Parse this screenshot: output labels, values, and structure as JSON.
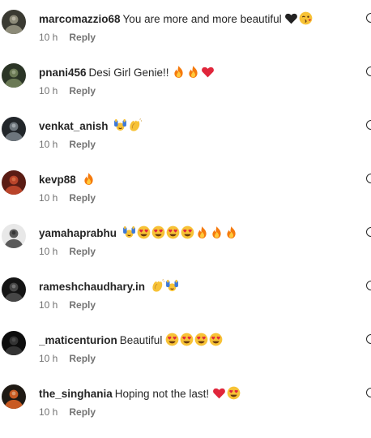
{
  "comments": [
    {
      "username": "marcomazzio68",
      "text": "You are more and more beautiful",
      "emojis": [
        "black-heart",
        "wink-kiss"
      ],
      "time": "10 h",
      "reply_label": "Reply",
      "avatar_colors": [
        "#3a3a32",
        "#8c8a78",
        "#d8d4c6"
      ]
    },
    {
      "username": "pnani456",
      "text": "Desi Girl Genie!!",
      "emojis": [
        "fire",
        "fire",
        "red-heart"
      ],
      "time": "10 h",
      "reply_label": "Reply",
      "avatar_colors": [
        "#2b3526",
        "#6b7a55",
        "#b7bfa4"
      ]
    },
    {
      "username": "venkat_anish",
      "text": "",
      "emojis": [
        "raising-hands",
        "clapping-hands"
      ],
      "time": "10 h",
      "reply_label": "Reply",
      "avatar_colors": [
        "#22262a",
        "#6d757c",
        "#c9ced2"
      ]
    },
    {
      "username": "kevp88",
      "text": "",
      "emojis": [
        "fire"
      ],
      "time": "10 h",
      "reply_label": "Reply",
      "avatar_colors": [
        "#5a1c14",
        "#b9442a",
        "#e98a56"
      ]
    },
    {
      "username": "yamahaprabhu",
      "text": "",
      "emojis": [
        "raising-hands",
        "heart-eyes",
        "heart-eyes",
        "heart-eyes",
        "heart-eyes",
        "fire",
        "fire",
        "fire"
      ],
      "time": "10 h",
      "reply_label": "Reply",
      "avatar_colors": [
        "#e8e8e8",
        "#5a5a5a",
        "#1c1c1c"
      ]
    },
    {
      "username": "rameshchaudhary.in",
      "text": "",
      "emojis": [
        "clapping-hands",
        "raising-hands"
      ],
      "time": "10 h",
      "reply_label": "Reply",
      "avatar_colors": [
        "#141414",
        "#464646",
        "#9a9a9a"
      ]
    },
    {
      "username": "_maticenturion",
      "text": "Beautiful",
      "emojis": [
        "heart-eyes",
        "heart-eyes",
        "heart-eyes",
        "heart-eyes"
      ],
      "time": "10 h",
      "reply_label": "Reply",
      "avatar_colors": [
        "#0d0d0d",
        "#333333",
        "#5e5e5e"
      ]
    },
    {
      "username": "the_singhania",
      "text": "Hoping not the last!",
      "emojis": [
        "red-heart",
        "heart-eyes"
      ],
      "time": "10 h",
      "reply_label": "Reply",
      "avatar_colors": [
        "#1f1a14",
        "#c85a22",
        "#e8c9a6"
      ]
    }
  ],
  "colors": {
    "username": "#262626",
    "text": "#262626",
    "meta": "#737373"
  }
}
